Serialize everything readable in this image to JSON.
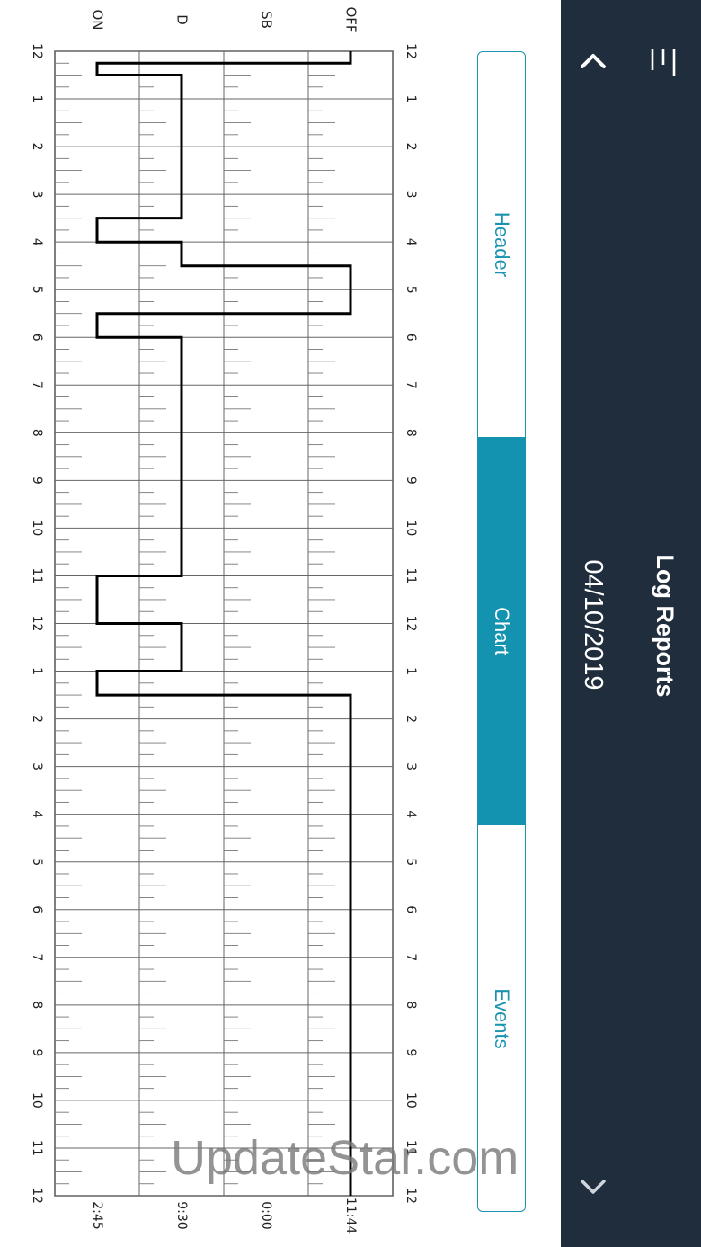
{
  "header": {
    "title": "Log Reports",
    "date": "04/10/2019",
    "menu_icon": "hamburger-menu-icon",
    "prev_icon": "chevron-up-icon",
    "next_icon": "chevron-down-icon",
    "background_color": "#1f2d3d"
  },
  "tabs": [
    {
      "label": "Header",
      "active": false
    },
    {
      "label": "Chart",
      "active": true
    },
    {
      "label": "Events",
      "active": false
    }
  ],
  "accent_color": "#1493b0",
  "watermark": "UpdateStar.com",
  "chart_data": {
    "type": "line",
    "status_rows": [
      "OFF",
      "SB",
      "D",
      "ON"
    ],
    "time_labels": [
      "12",
      "1",
      "2",
      "3",
      "4",
      "5",
      "6",
      "7",
      "8",
      "9",
      "10",
      "11",
      "12",
      "1",
      "2",
      "3",
      "4",
      "5",
      "6",
      "7",
      "8",
      "9",
      "10",
      "11",
      "12"
    ],
    "row_totals": [
      "11:44",
      "0:00",
      "9:30",
      "2:45"
    ],
    "grid": true,
    "series": [
      {
        "points": [
          {
            "hour": 0,
            "status": "OFF"
          },
          {
            "hour": 0.25,
            "status": "OFF"
          },
          {
            "hour": 0.25,
            "status": "ON"
          },
          {
            "hour": 0.5,
            "status": "ON"
          },
          {
            "hour": 0.5,
            "status": "D"
          },
          {
            "hour": 3.5,
            "status": "D"
          },
          {
            "hour": 3.5,
            "status": "ON"
          },
          {
            "hour": 4,
            "status": "ON"
          },
          {
            "hour": 4,
            "status": "D"
          },
          {
            "hour": 4.5,
            "status": "D"
          },
          {
            "hour": 4.5,
            "status": "OFF"
          },
          {
            "hour": 5.5,
            "status": "OFF"
          },
          {
            "hour": 5.5,
            "status": "ON"
          },
          {
            "hour": 6,
            "status": "ON"
          },
          {
            "hour": 6,
            "status": "D"
          },
          {
            "hour": 11,
            "status": "D"
          },
          {
            "hour": 11,
            "status": "ON"
          },
          {
            "hour": 12,
            "status": "ON"
          },
          {
            "hour": 12,
            "status": "D"
          },
          {
            "hour": 13,
            "status": "D"
          },
          {
            "hour": 13,
            "status": "ON"
          },
          {
            "hour": 13.5,
            "status": "ON"
          },
          {
            "hour": 13.5,
            "status": "OFF"
          },
          {
            "hour": 24,
            "status": "OFF"
          }
        ]
      }
    ]
  }
}
